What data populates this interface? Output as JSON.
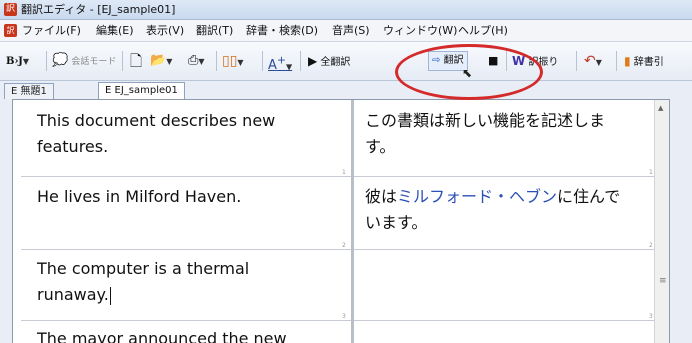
{
  "window": {
    "title": "翻訳エディタ - [EJ_sample01]",
    "app_icon": "translate-app-icon"
  },
  "menu": [
    "ファイル(F)",
    "編集(E)",
    "表示(V)",
    "翻訳(T)",
    "辞書・検索(D)",
    "音声(S)",
    "ウィンドウ(W)",
    "ヘルプ(H)"
  ],
  "toolbar": {
    "mode_label": "B›J",
    "conversation_mode": "会話モード",
    "translate_all": "全翻訳",
    "translate": "翻訳",
    "word_translation": "訳振り",
    "dictionary": "辞書引"
  },
  "tabs": [
    {
      "label": "E 無題1",
      "active": false
    },
    {
      "label": "E EJ_sample01",
      "active": true
    }
  ],
  "rows": [
    {
      "source": [
        "This document describes new",
        "features."
      ],
      "target": [
        "この書類は新しい機能を記述しま",
        "す。"
      ],
      "num": "1"
    },
    {
      "source": [
        "He lives in Milford Haven."
      ],
      "target_pre": "彼は",
      "target_hl": "ミルフォード・ヘブン",
      "target_post": "に住んで",
      "target_line2": "います。",
      "num": "2"
    },
    {
      "source": [
        "The computer is a thermal",
        "runaway."
      ],
      "num": "3"
    },
    {
      "source": [
        "The mayor announced the new"
      ]
    }
  ],
  "colors": {
    "highlight_ring": "#d42a2a",
    "hl_text": "#2c4fb8"
  }
}
